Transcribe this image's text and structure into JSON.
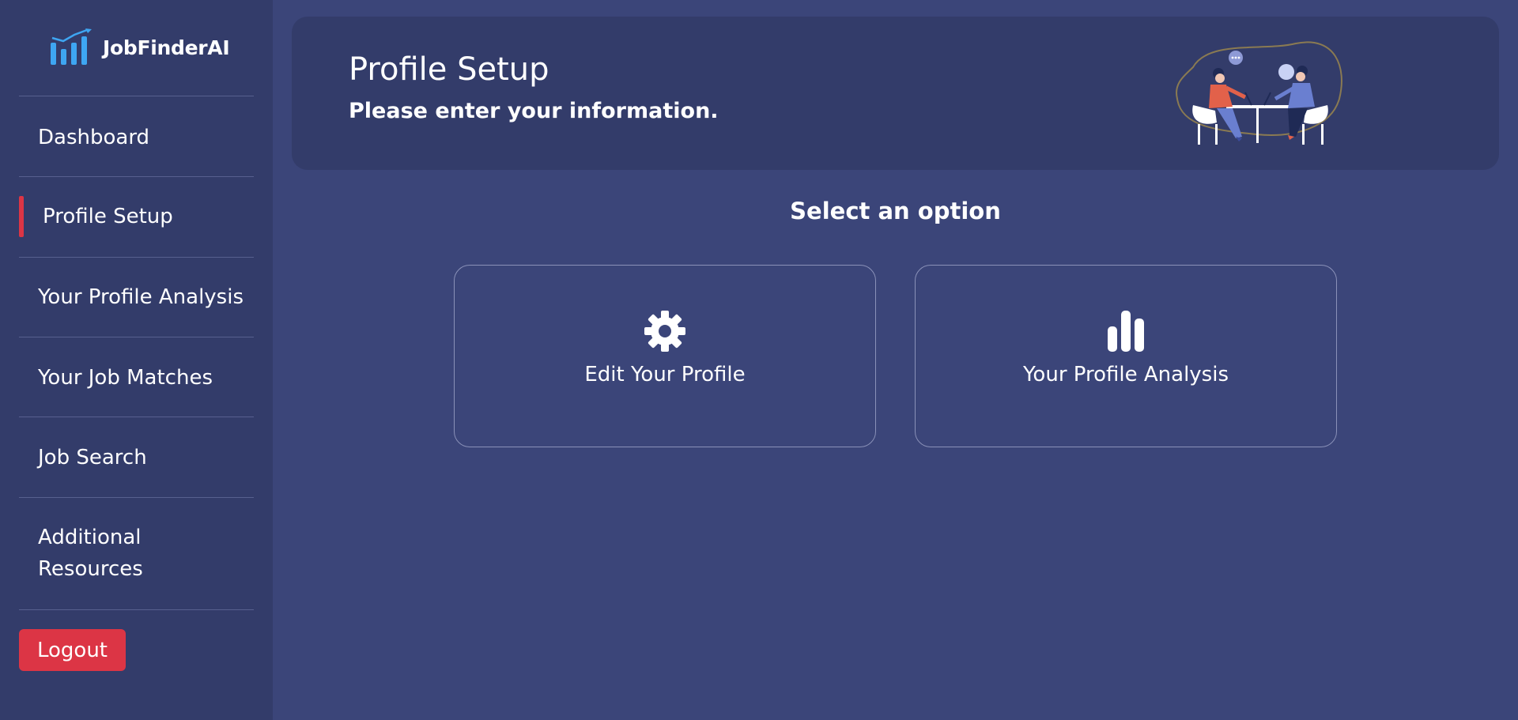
{
  "brand": {
    "name": "JobFinderAI",
    "icon": "bar-chart-trend-icon"
  },
  "sidebar": {
    "items": [
      {
        "label": "Dashboard",
        "active": false
      },
      {
        "label": "Profile Setup",
        "active": true
      },
      {
        "label": "Your Profile Analysis",
        "active": false
      },
      {
        "label": "Your Job Matches",
        "active": false
      },
      {
        "label": "Job Search",
        "active": false
      },
      {
        "label": "Additional Resources",
        "active": false
      }
    ],
    "logout_label": "Logout"
  },
  "header": {
    "title": "Profile Setup",
    "subtitle": "Please enter your information."
  },
  "main": {
    "section_title": "Select an option",
    "options": [
      {
        "label": "Edit Your Profile",
        "icon": "gear-icon"
      },
      {
        "label": "Your Profile Analysis",
        "icon": "bar-chart-icon"
      }
    ]
  },
  "colors": {
    "background": "#3b4579",
    "sidebar": "#333c6a",
    "accent": "#dc3545",
    "brand_icon": "#3ea6f2"
  }
}
